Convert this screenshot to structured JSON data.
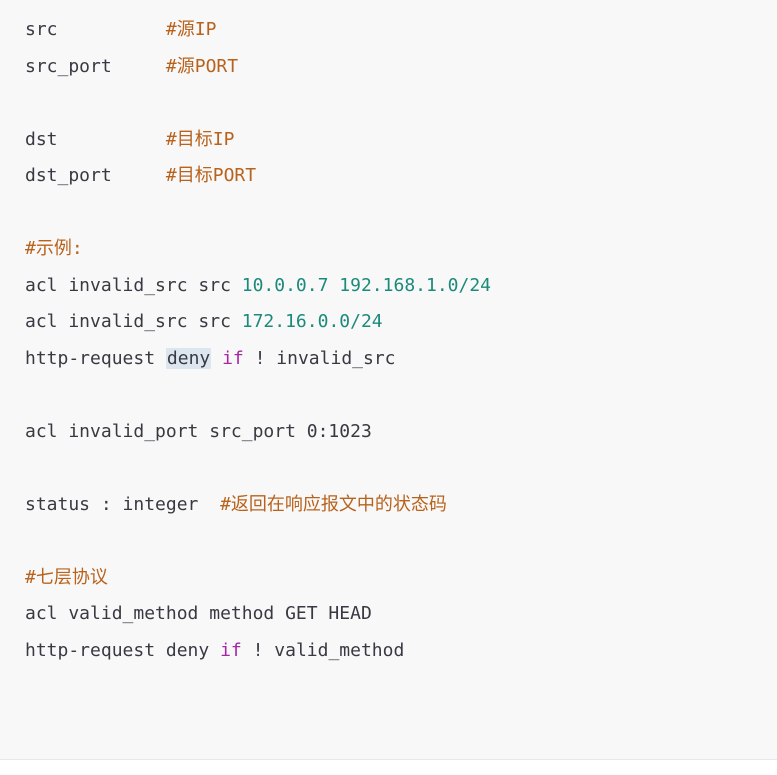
{
  "code_block": {
    "lines": [
      {
        "tokens": [
          {
            "text": "src          ",
            "kind": "plain"
          },
          {
            "text": "#源IP",
            "kind": "comment"
          }
        ]
      },
      {
        "tokens": [
          {
            "text": "src_port     ",
            "kind": "plain"
          },
          {
            "text": "#源PORT",
            "kind": "comment"
          }
        ]
      },
      {
        "tokens": []
      },
      {
        "tokens": [
          {
            "text": "dst          ",
            "kind": "plain"
          },
          {
            "text": "#目标IP",
            "kind": "comment"
          }
        ]
      },
      {
        "tokens": [
          {
            "text": "dst_port     ",
            "kind": "plain"
          },
          {
            "text": "#目标PORT",
            "kind": "comment"
          }
        ]
      },
      {
        "tokens": []
      },
      {
        "tokens": [
          {
            "text": "#示例:",
            "kind": "comment"
          }
        ]
      },
      {
        "tokens": [
          {
            "text": "acl invalid_src src ",
            "kind": "plain"
          },
          {
            "text": "10.0.0.7",
            "kind": "number"
          },
          {
            "text": " ",
            "kind": "plain"
          },
          {
            "text": "192.168.1.0/24",
            "kind": "number"
          }
        ]
      },
      {
        "tokens": [
          {
            "text": "acl invalid_src src ",
            "kind": "plain"
          },
          {
            "text": "172.16.0.0/24",
            "kind": "number"
          }
        ]
      },
      {
        "tokens": [
          {
            "text": "http-request ",
            "kind": "plain"
          },
          {
            "text": "deny",
            "kind": "highlight"
          },
          {
            "text": " ",
            "kind": "plain"
          },
          {
            "text": "if",
            "kind": "keyword"
          },
          {
            "text": " ! invalid_src",
            "kind": "plain"
          }
        ]
      },
      {
        "tokens": []
      },
      {
        "tokens": [
          {
            "text": "acl invalid_port src_port 0:1023",
            "kind": "plain"
          }
        ]
      },
      {
        "tokens": []
      },
      {
        "tokens": [
          {
            "text": "status : integer  ",
            "kind": "plain"
          },
          {
            "text": "#返回在响应报文中的状态码",
            "kind": "comment"
          }
        ]
      },
      {
        "tokens": []
      },
      {
        "tokens": [
          {
            "text": "#七层协议",
            "kind": "comment"
          }
        ]
      },
      {
        "tokens": [
          {
            "text": "acl valid_method method GET HEAD",
            "kind": "plain"
          }
        ]
      },
      {
        "tokens": [
          {
            "text": "http-request deny ",
            "kind": "plain"
          },
          {
            "text": "if",
            "kind": "keyword"
          },
          {
            "text": " ! valid_method",
            "kind": "plain"
          }
        ]
      }
    ]
  },
  "colors": {
    "background": "#f8f8f9",
    "text": "#383a42",
    "comment": "#b8621c",
    "number": "#1c8a7a",
    "keyword": "#a626a4",
    "highlight": "#dde5ef"
  }
}
